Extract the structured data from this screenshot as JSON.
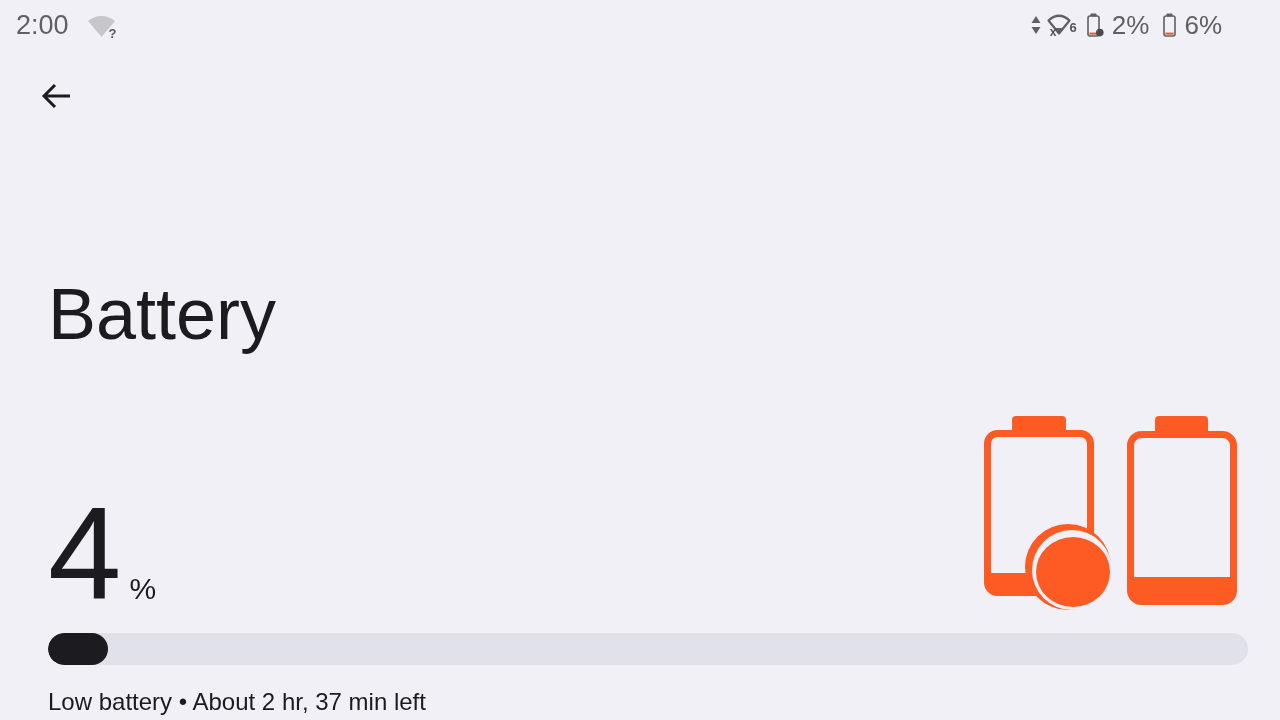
{
  "status_bar": {
    "time": "2:00",
    "wifi": {
      "mark": "?"
    },
    "signal": {
      "no_data_mark": "x",
      "network_label": "6"
    },
    "batteries": [
      {
        "kind": "dotted",
        "percent": "2%"
      },
      {
        "kind": "plain",
        "percent": "6%"
      }
    ]
  },
  "title": "Battery",
  "battery": {
    "value": "4",
    "unit": "%",
    "level": 0.05,
    "status": "Low battery • About 2 hr, 37 min left"
  }
}
